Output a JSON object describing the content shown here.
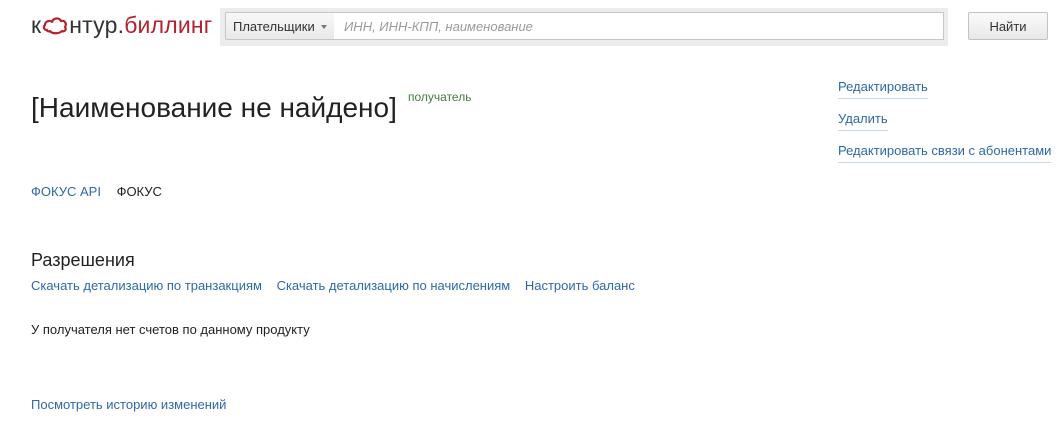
{
  "header": {
    "logo": {
      "part1": "к",
      "part2": "нтур.",
      "product": "биллинг",
      "brand_color": "#b3232f",
      "mark_icon": "kontur-logo-mark-icon"
    },
    "search": {
      "scope_label": "Плательщики",
      "placeholder": "ИНН, ИНН-КПП, наименование",
      "value": ""
    },
    "find_label": "Найти"
  },
  "page": {
    "title": "[Наименование не найдено]",
    "role_tag": "получатель"
  },
  "actions": [
    {
      "label": "Редактировать"
    },
    {
      "label": "Удалить"
    },
    {
      "label": "Редактировать связи с абонентами"
    }
  ],
  "product_tabs": [
    {
      "label": "ФОКУС API",
      "active": false
    },
    {
      "label": "ФОКУС",
      "active": true
    }
  ],
  "permissions": {
    "title": "Разрешения",
    "links": [
      {
        "label": "Скачать детализацию по транзакциям"
      },
      {
        "label": "Скачать детализацию по начислениям"
      },
      {
        "label": "Настроить баланс"
      }
    ],
    "empty_note": "У получателя нет счетов по данному продукту"
  },
  "footer": {
    "history_label": "Посмотреть историю изменений"
  },
  "colors": {
    "link": "#2f68a8",
    "tag": "#3f7f3a",
    "text": "#222222"
  }
}
